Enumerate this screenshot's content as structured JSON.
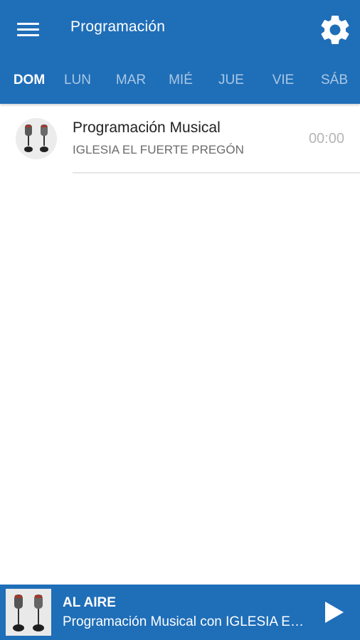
{
  "header": {
    "title": "Programación",
    "menu_icon": "hamburger-menu-icon",
    "settings_icon": "gear-icon",
    "background_color": "#1f6eb8"
  },
  "tabs": [
    {
      "label": "DOM",
      "active": true
    },
    {
      "label": "LUN",
      "active": false
    },
    {
      "label": "MAR",
      "active": false
    },
    {
      "label": "MIÉ",
      "active": false
    },
    {
      "label": "JUE",
      "active": false
    },
    {
      "label": "VIE",
      "active": false
    },
    {
      "label": "SÁB",
      "active": false
    }
  ],
  "schedule": [
    {
      "title": "Programación Musical",
      "subtitle": "IGLESIA EL FUERTE PREGÓN",
      "time": "00:00",
      "icon": "microphones-icon"
    }
  ],
  "player": {
    "label": "AL AIRE",
    "description": "Programación Musical con IGLESIA EL FUERTE PREGÓN",
    "play_icon": "play-icon",
    "thumb_icon": "microphones-icon"
  }
}
